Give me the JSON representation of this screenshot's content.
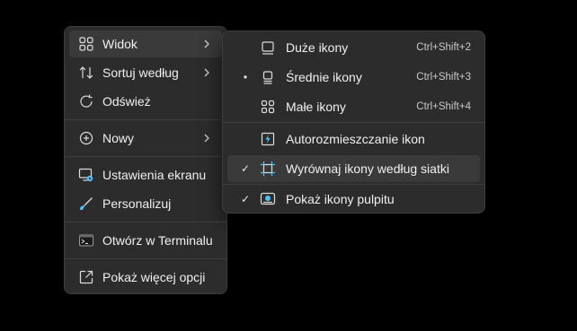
{
  "main_menu": {
    "items": [
      {
        "label": "Widok",
        "icon": "grid-icon"
      },
      {
        "label": "Sortuj według",
        "icon": "sort-icon"
      },
      {
        "label": "Odśwież",
        "icon": "refresh-icon"
      },
      {
        "label": "Nowy",
        "icon": "plus-circle-icon"
      },
      {
        "label": "Ustawienia ekranu",
        "icon": "display-settings-icon"
      },
      {
        "label": "Personalizuj",
        "icon": "brush-icon"
      },
      {
        "label": "Otwórz w Terminalu",
        "icon": "terminal-icon"
      },
      {
        "label": "Pokaż więcej opcji",
        "icon": "more-options-icon"
      }
    ]
  },
  "sub_menu": {
    "items": [
      {
        "label": "Duże ikony",
        "shortcut": "Ctrl+Shift+2",
        "icon": "large-icons-icon",
        "selected": false
      },
      {
        "label": "Średnie ikony",
        "shortcut": "Ctrl+Shift+3",
        "icon": "medium-icons-icon",
        "selected": true,
        "mark": "•"
      },
      {
        "label": "Małe ikony",
        "shortcut": "Ctrl+Shift+4",
        "icon": "small-icons-icon",
        "selected": false
      },
      {
        "label": "Autorozmieszczanie ikon",
        "icon": "auto-arrange-icon",
        "checked": false
      },
      {
        "label": "Wyrównaj ikony według siatki",
        "icon": "align-grid-icon",
        "checked": true,
        "mark": "✓"
      },
      {
        "label": "Pokaż ikony pulpitu",
        "icon": "show-desktop-icons-icon",
        "checked": true,
        "mark": "✓"
      }
    ]
  },
  "colors": {
    "menu_bg": "#2c2c2c",
    "hover_bg": "#3a3a3a",
    "accent": "#4cc2ff"
  }
}
